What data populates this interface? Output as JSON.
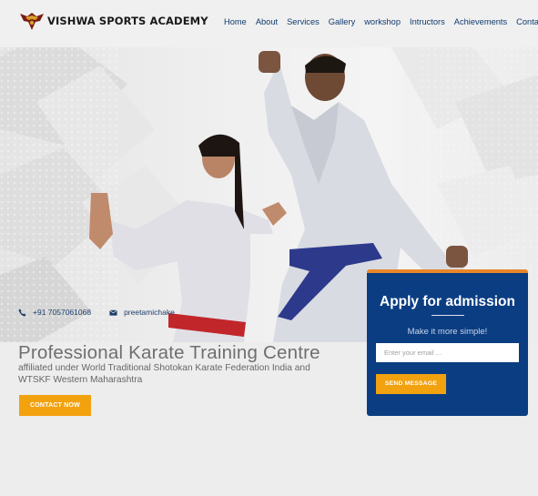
{
  "brand": {
    "name": "VISHWA SPORTS ACADEMY",
    "logo_icon": "eagle-shield-icon"
  },
  "nav": {
    "items": [
      {
        "label": "Home"
      },
      {
        "label": "About"
      },
      {
        "label": "Services"
      },
      {
        "label": "Gallery"
      },
      {
        "label": "workshop"
      },
      {
        "label": "Intructors"
      },
      {
        "label": "Achievements"
      },
      {
        "label": "Contact"
      }
    ]
  },
  "hero": {
    "phone": "+91 7057061068",
    "email": "preetamichake",
    "title": "Professional Karate Training Centre",
    "subtitle": "affiliated under World Traditional Shotokan Karate Federation India and WTSKF Western Maharashtra",
    "cta_label": "CONTACT NOW"
  },
  "admission": {
    "title": "Apply for admission",
    "subtitle": "Make it more simple!",
    "email_placeholder": "Enter your email ...",
    "email_value": "",
    "send_label": "SEND MESSAGE"
  },
  "colors": {
    "brand_blue": "#0b3d82",
    "accent_orange": "#f2a20f",
    "nav_text": "#0e3a6e"
  }
}
